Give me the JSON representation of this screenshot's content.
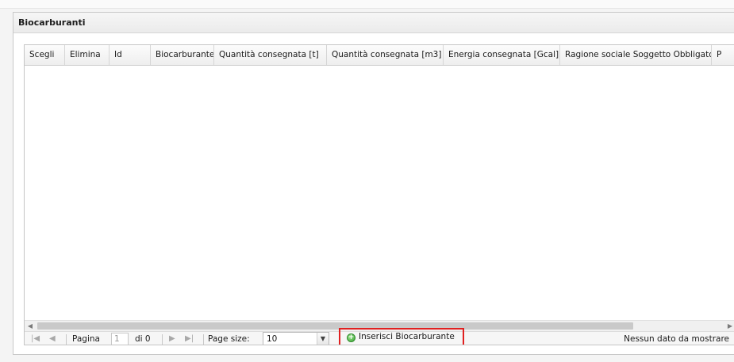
{
  "panel": {
    "title": "Biocarburanti"
  },
  "grid": {
    "columns": [
      "Scegli",
      "Elimina",
      "Id",
      "Biocarburante",
      "Quantità consegnata [t]",
      "Quantità consegnata [m3]",
      "Energia consegnata [Gcal]",
      "Ragione sociale Soggetto Obbligato",
      "P"
    ]
  },
  "pager": {
    "page_label": "Pagina",
    "page_value": "1",
    "of_label": "di 0",
    "page_size_label": "Page size:",
    "page_size_value": "10",
    "insert_label": "Inserisci Biocarburante",
    "status": "Nessun dato da mostrare"
  },
  "icons": {
    "first": "first-page-icon",
    "prev": "prev-page-icon",
    "next": "next-page-icon",
    "last": "last-page-icon",
    "add": "add-circle-icon"
  },
  "colors": {
    "highlight": "#e02020",
    "add_icon": "#3aa635"
  }
}
